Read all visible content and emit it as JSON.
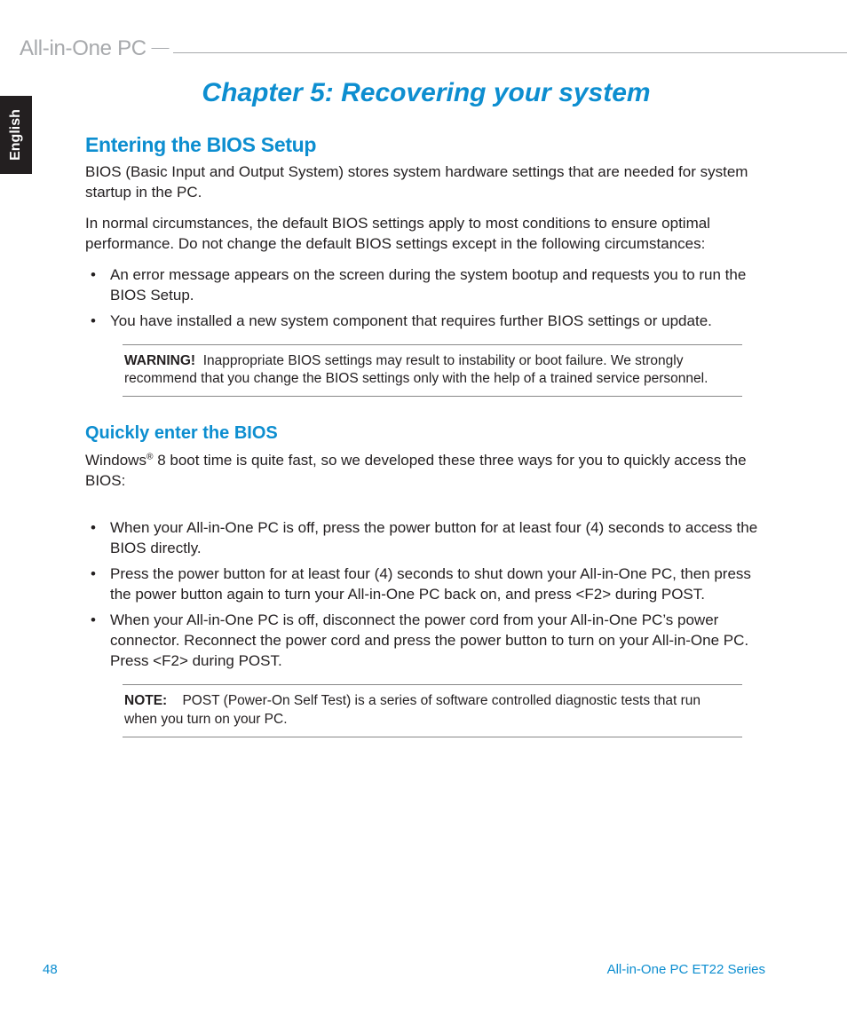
{
  "header": {
    "label": "All-in-One PC"
  },
  "langTab": "English",
  "chapter": {
    "title": "Chapter 5: Recovering your system"
  },
  "section1": {
    "heading": "Entering the BIOS Setup",
    "p1": "BIOS (Basic Input and Output System) stores system hardware settings that are needed for system startup in the PC.",
    "p2": "In normal circumstances, the default BIOS settings apply to most conditions to ensure optimal performance. Do not change the default BIOS settings except in the following circumstances:",
    "bullets": [
      "An error message appears on the screen during the system bootup and requests you to run the BIOS Setup.",
      "You have installed a new system component that requires further BIOS settings or update."
    ],
    "warning": {
      "label": "WARNING!",
      "text": "Inappropriate BIOS settings may result to instability or boot failure. We strongly recommend that you change the BIOS settings only with the help of a trained service personnel."
    }
  },
  "section2": {
    "heading": "Quickly enter the BIOS",
    "p1a": "Windows",
    "p1b": " 8 boot time is quite fast, so we developed these three ways for you to quickly access the BIOS:",
    "bullets": [
      "When your All-in-One PC is off, press the power button for at least four (4) seconds to access the BIOS directly.",
      "Press the power button for at least four (4) seconds to shut down your All-in-One PC, then press the power button again to turn your All-in-One PC back on, and press <F2> during POST.",
      "When your All-in-One PC is off, disconnect the power cord from your All-in-One PC’s power connector. Reconnect the power cord and press the power button to turn on your All-in-One PC. Press <F2> during POST."
    ],
    "note": {
      "label": "NOTE:",
      "text": "POST (Power-On Self Test) is a series of software controlled diagnostic tests that run when you turn on your PC."
    }
  },
  "footer": {
    "pageNum": "48",
    "series": "All-in-One PC ET22 Series"
  }
}
